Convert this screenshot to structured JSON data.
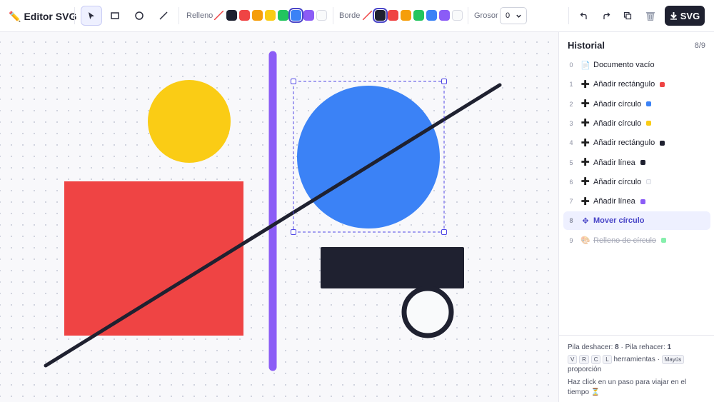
{
  "app": {
    "title": "Editor SVG",
    "title_emoji": "✏️"
  },
  "toolbar": {
    "tools": [
      "select-tool",
      "rectangle-tool",
      "circle-tool",
      "line-tool"
    ],
    "active_tool": "select-tool",
    "fill_label": "Relleno",
    "fill_colors": [
      "none",
      "#1f2130",
      "#ef4444",
      "#f59e0b",
      "#facc15",
      "#22c55e",
      "#3b82f6",
      "#8b5cf6",
      "#f9fafb"
    ],
    "fill_selected": "#3b82f6",
    "stroke_label": "Borde",
    "stroke_colors": [
      "none",
      "#1f2130",
      "#ef4444",
      "#f59e0b",
      "#22c55e",
      "#3b82f6",
      "#8b5cf6",
      "#f9fafb"
    ],
    "stroke_selected": "#1f2130",
    "width_label": "Grosor",
    "width_value": "0",
    "export_label": "SVG"
  },
  "canvas": {
    "shapes": [
      {
        "kind": "circle",
        "fill": "#facc15"
      },
      {
        "kind": "rect",
        "fill": "#ef4444"
      },
      {
        "kind": "line",
        "stroke": "#8b5cf6"
      },
      {
        "kind": "circle",
        "fill": "#3b82f6",
        "selected": true
      },
      {
        "kind": "rect",
        "fill": "#1f2130"
      },
      {
        "kind": "circle",
        "fill": "#f9fafb",
        "stroke": "#1f2130"
      },
      {
        "kind": "line",
        "stroke": "#1f2130"
      }
    ]
  },
  "history": {
    "title": "Historial",
    "count": "8/9",
    "items": [
      {
        "num": "0",
        "icon": "📄",
        "label": "Documento vacío",
        "color": null,
        "state": "past"
      },
      {
        "num": "1",
        "icon": "➕",
        "label": "Añadir rectángulo",
        "color": "#ef4444",
        "state": "past"
      },
      {
        "num": "2",
        "icon": "➕",
        "label": "Añadir círculo",
        "color": "#3b82f6",
        "state": "past"
      },
      {
        "num": "3",
        "icon": "➕",
        "label": "Añadir círculo",
        "color": "#facc15",
        "state": "past"
      },
      {
        "num": "4",
        "icon": "➕",
        "label": "Añadir rectángulo",
        "color": "#1f2130",
        "state": "past"
      },
      {
        "num": "5",
        "icon": "➕",
        "label": "Añadir línea",
        "color": "#1f2130",
        "state": "past"
      },
      {
        "num": "6",
        "icon": "➕",
        "label": "Añadir círculo",
        "color": "#f9fafb",
        "state": "past"
      },
      {
        "num": "7",
        "icon": "➕",
        "label": "Añadir línea",
        "color": "#8b5cf6",
        "state": "past"
      },
      {
        "num": "8",
        "icon": "✥",
        "label": "Mover círculo",
        "color": null,
        "state": "current"
      },
      {
        "num": "9",
        "icon": "🎨",
        "label": "Relleno de círculo",
        "color": "#86efac",
        "state": "future"
      }
    ],
    "footer": {
      "undo_label": "Pila deshacer:",
      "undo_value": "8",
      "redo_label": "· Pila rehacer:",
      "redo_value": "1",
      "keys": [
        "V",
        "R",
        "C",
        "L"
      ],
      "tools_text": "herramientas ·",
      "shift_key": "Mayús",
      "proportion_text": "proporción",
      "hint": "Haz click en un paso para viajar en el tiempo",
      "hint_emoji": "⏳"
    }
  }
}
